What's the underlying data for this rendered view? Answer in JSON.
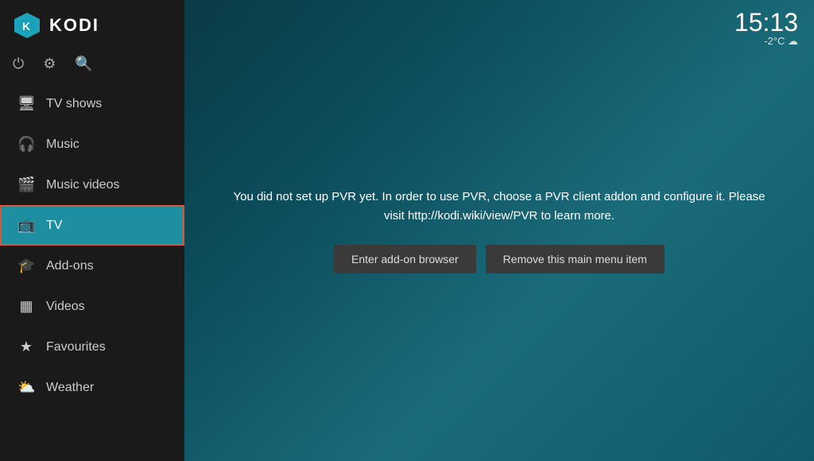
{
  "app": {
    "title": "KODI"
  },
  "clock": {
    "time": "15:13",
    "temperature": "-2°C",
    "weather_icon": "☁"
  },
  "sidebar": {
    "icons": [
      {
        "name": "power-icon",
        "symbol": "⏻"
      },
      {
        "name": "settings-icon",
        "symbol": "⚙"
      },
      {
        "name": "search-icon",
        "symbol": "🔍"
      }
    ],
    "items": [
      {
        "id": "tv-shows",
        "label": "TV shows",
        "icon": "🖥",
        "active": false
      },
      {
        "id": "music",
        "label": "Music",
        "icon": "🎧",
        "active": false
      },
      {
        "id": "music-videos",
        "label": "Music videos",
        "icon": "🎬",
        "active": false
      },
      {
        "id": "tv",
        "label": "TV",
        "icon": "📺",
        "active": true
      },
      {
        "id": "add-ons",
        "label": "Add-ons",
        "icon": "🎓",
        "active": false
      },
      {
        "id": "videos",
        "label": "Videos",
        "icon": "▦",
        "active": false
      },
      {
        "id": "favourites",
        "label": "Favourites",
        "icon": "★",
        "active": false
      },
      {
        "id": "weather",
        "label": "Weather",
        "icon": "⛅",
        "active": false
      }
    ]
  },
  "pvr": {
    "message": "You did not set up PVR yet. In order to use PVR, choose a PVR client addon and configure it. Please visit http://kodi.wiki/view/PVR to learn more.",
    "button_addon": "Enter add-on browser",
    "button_remove": "Remove this main menu item"
  }
}
